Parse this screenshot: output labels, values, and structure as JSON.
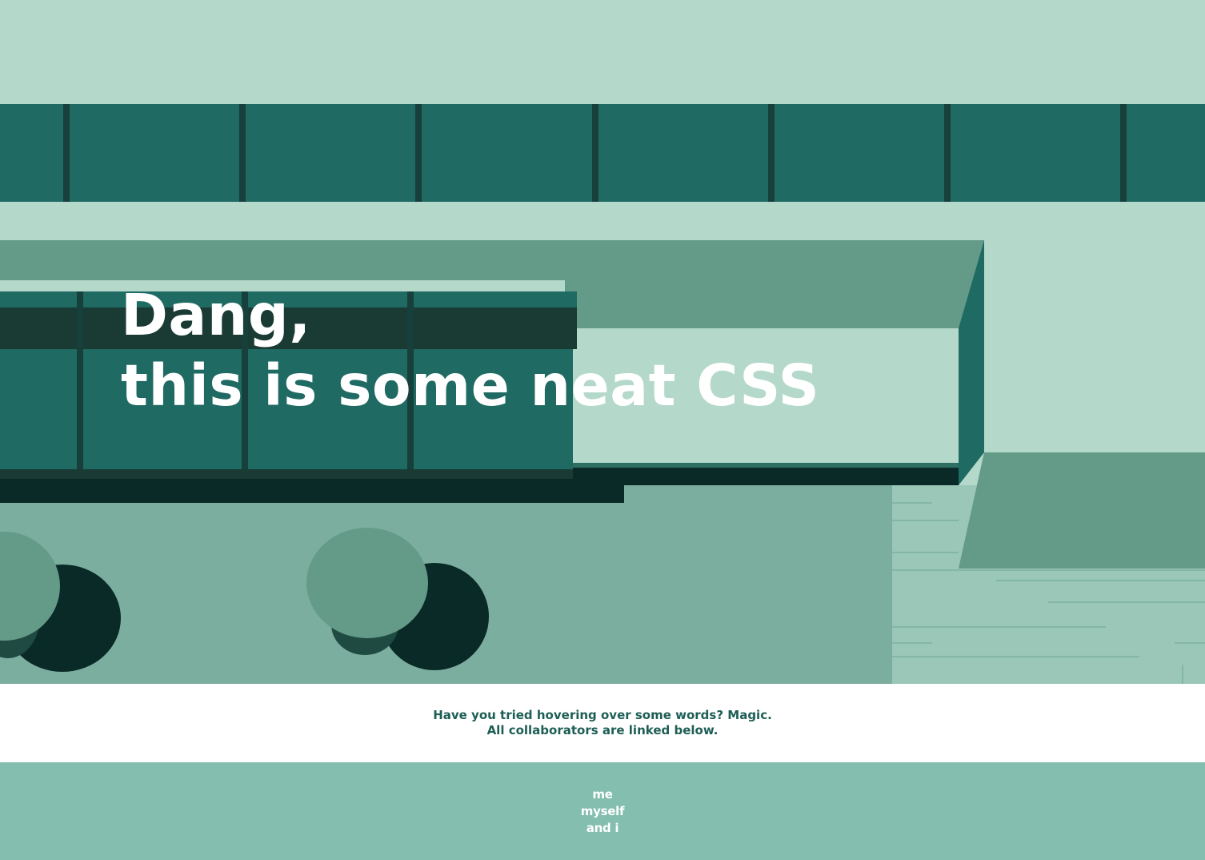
{
  "hero": {
    "headline_line1": "Dang,",
    "headline_line2": "this is some neat CSS"
  },
  "hint": {
    "line1": "Have you tried hovering over some words? Magic.",
    "line2": "All collaborators are linked below."
  },
  "footer": {
    "links": [
      "me",
      "myself",
      "and i"
    ]
  },
  "colors": {
    "sky": "#b4d9cb",
    "dark_teal": "#1f6a63",
    "darkest": "#0a2a27",
    "mid_green": "#639a88",
    "ground": "#7bae9e",
    "footer_bg": "#83beaf",
    "hint_text": "#1d5e55"
  }
}
